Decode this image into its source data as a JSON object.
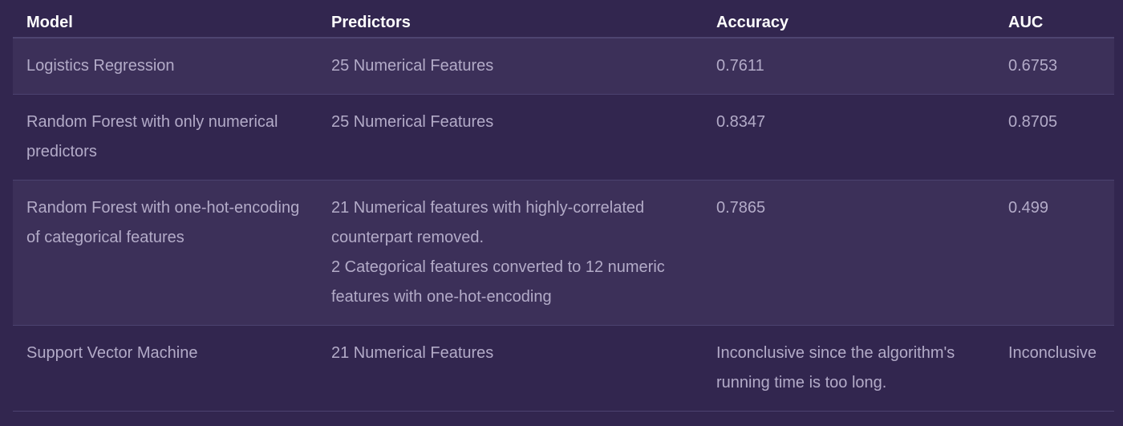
{
  "table": {
    "headers": [
      "Model",
      "Predictors",
      "Accuracy",
      "AUC"
    ],
    "rows": [
      {
        "model": "Logistics Regression",
        "predictors": [
          "25 Numerical Features"
        ],
        "accuracy": "0.7611",
        "auc": "0.6753"
      },
      {
        "model": "Random Forest with only numerical predictors",
        "predictors": [
          "25 Numerical Features"
        ],
        "accuracy": "0.8347",
        "auc": "0.8705"
      },
      {
        "model": "Random Forest with one-hot-encoding of categorical features",
        "predictors": [
          "21 Numerical features with highly-correlated counterpart removed.",
          "2 Categorical features converted to 12 numeric features with one-hot-encoding"
        ],
        "accuracy": "0.7865",
        "auc": "0.499"
      },
      {
        "model": "Support Vector Machine",
        "predictors": [
          "21 Numerical Features"
        ],
        "accuracy": "Inconclusive since the algorithm's running time is too long.",
        "auc": "Inconclusive"
      }
    ]
  },
  "colors": {
    "background": "#32264f",
    "row_stripe": "#3c3059",
    "header_text": "#ffffff",
    "cell_text": "#b3abc8",
    "divider": "#4c4270"
  }
}
